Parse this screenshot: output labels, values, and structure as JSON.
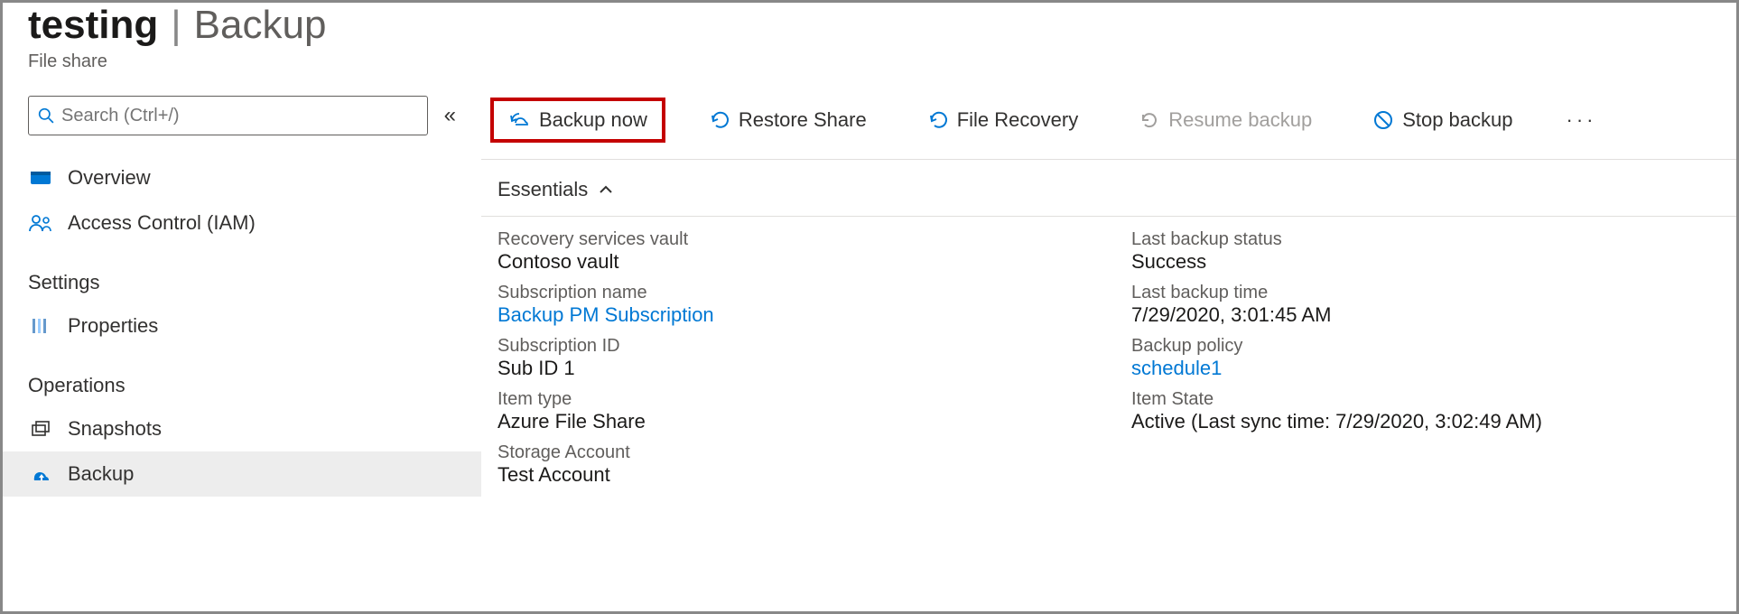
{
  "header": {
    "title_main": "testing",
    "title_section": "Backup",
    "subtitle": "File share"
  },
  "sidebar": {
    "search_placeholder": "Search (Ctrl+/)",
    "items_top": [
      {
        "label": "Overview"
      },
      {
        "label": "Access Control (IAM)"
      }
    ],
    "group_settings": "Settings",
    "items_settings": [
      {
        "label": "Properties"
      }
    ],
    "group_operations": "Operations",
    "items_operations": [
      {
        "label": "Snapshots"
      },
      {
        "label": "Backup"
      }
    ]
  },
  "toolbar": {
    "backup_now": "Backup now",
    "restore_share": "Restore Share",
    "file_recovery": "File Recovery",
    "resume_backup": "Resume backup",
    "stop_backup": "Stop backup"
  },
  "essentials": {
    "header": "Essentials",
    "left": {
      "recovery_vault_label": "Recovery services vault",
      "recovery_vault_value": "Contoso vault",
      "subscription_name_label": "Subscription name",
      "subscription_name_value": "Backup PM Subscription",
      "subscription_id_label": "Subscription ID",
      "subscription_id_value": "Sub ID 1",
      "item_type_label": "Item type",
      "item_type_value": "Azure File Share",
      "storage_account_label": "Storage Account",
      "storage_account_value": "Test Account"
    },
    "right": {
      "last_backup_status_label": "Last backup status",
      "last_backup_status_value": "Success",
      "last_backup_time_label": "Last backup time",
      "last_backup_time_value": "7/29/2020, 3:01:45 AM",
      "backup_policy_label": "Backup policy",
      "backup_policy_value": "schedule1",
      "item_state_label": "Item State",
      "item_state_value": "Active (Last sync time: 7/29/2020, 3:02:49 AM)"
    }
  }
}
